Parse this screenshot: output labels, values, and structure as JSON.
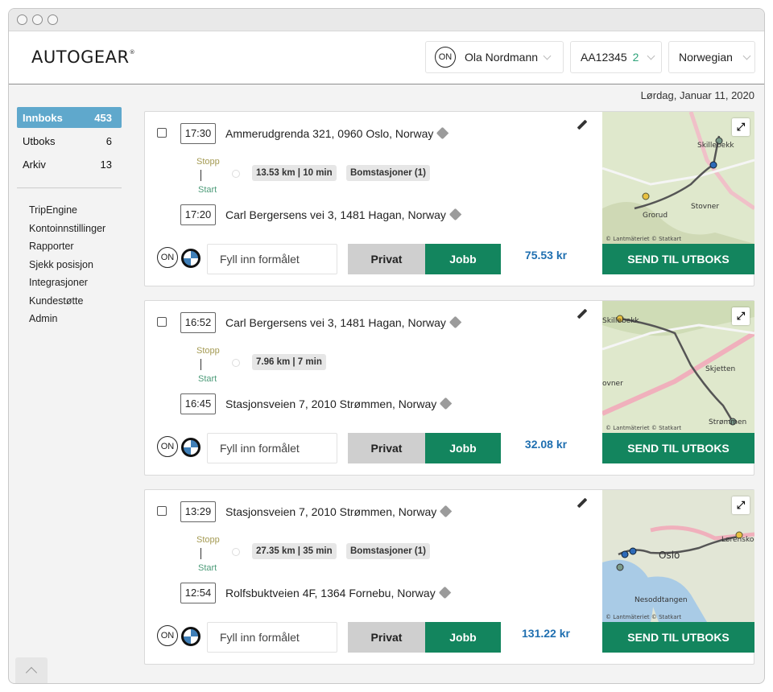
{
  "header": {
    "logo": "AUTOGEAR",
    "logo_mark": "®",
    "user_badge": "ON",
    "user_name": "Ola Nordmann",
    "vehicle_plate": "AA12345",
    "vehicle_count": "2",
    "language": "Norwegian"
  },
  "date": "Lørdag, Januar 11, 2020",
  "sidebar": {
    "folders": [
      {
        "label": "Innboks",
        "count": "453"
      },
      {
        "label": "Utboks",
        "count": "6"
      },
      {
        "label": "Arkiv",
        "count": "13"
      }
    ],
    "links": [
      "TripEngine",
      "Kontoinnstillinger",
      "Rapporter",
      "Sjekk posisjon",
      "Integrasjoner",
      "Kundestøtte",
      "Admin"
    ]
  },
  "labels": {
    "stopp": "Stopp",
    "start": "Start",
    "purpose_placeholder": "Fyll inn formålet",
    "privat": "Privat",
    "jobb": "Jobb",
    "send": "SEND TIL UTBOKS",
    "on_badge": "ON",
    "map_credit": "© Lantmäteriet  © Statkart"
  },
  "trips": [
    {
      "stop_time": "17:30",
      "stop_address": "Ammerudgrenda 321, 0960 Oslo, Norway",
      "start_time": "17:20",
      "start_address": "Carl Bergersens vei 3, 1481 Hagan, Norway",
      "distance": "13.53 km | 10 min",
      "toll": "Bomstasjoner (1)",
      "amount": "75.53 kr",
      "map_labels": [
        "Skillebekk",
        "Stovner",
        "Grorud"
      ]
    },
    {
      "stop_time": "16:52",
      "stop_address": "Carl Bergersens vei 3, 1481 Hagan, Norway",
      "start_time": "16:45",
      "start_address": "Stasjonsveien 7, 2010 Strømmen, Norway",
      "distance": "7.96 km | 7 min",
      "toll": "",
      "amount": "32.08 kr",
      "map_labels": [
        "Skillebekk",
        "Skjetten",
        "ovner",
        "Strømmen"
      ]
    },
    {
      "stop_time": "13:29",
      "stop_address": "Stasjonsveien 7, 2010 Strømmen, Norway",
      "start_time": "12:54",
      "start_address": "Rolfsbuktveien 4F, 1364 Fornebu, Norway",
      "distance": "27.35 km | 35 min",
      "toll": "Bomstasjoner (1)",
      "amount": "131.22 kr",
      "map_labels": [
        "Oslo",
        "Lørenskog",
        "Nesoddtangen"
      ]
    }
  ],
  "colors": {
    "accent_green": "#13855e",
    "sidebar_active": "#5fa8cc",
    "amount_blue": "#1f6fb0"
  }
}
